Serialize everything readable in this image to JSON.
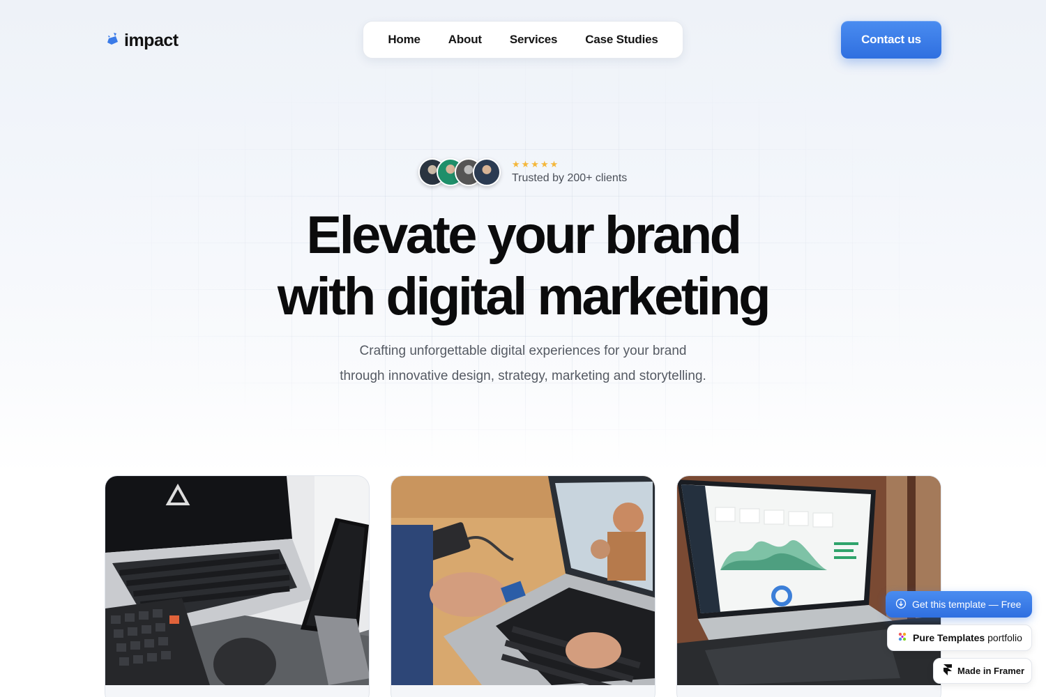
{
  "brand": {
    "name": "impact",
    "accent": "#2f6fe0"
  },
  "nav": {
    "items": [
      "Home",
      "About",
      "Services",
      "Case Studies"
    ]
  },
  "header": {
    "contact_label": "Contact us"
  },
  "trust": {
    "stars": "★★★★★",
    "rating": 5,
    "label": "Trusted by 200+ clients",
    "avatar_count": 4
  },
  "hero": {
    "headline_line1": "Elevate your brand",
    "headline_line2": "with digital marketing",
    "sub_line1": "Crafting unforgettable digital experiences for your brand",
    "sub_line2": "through innovative design, strategy, marketing and storytelling."
  },
  "cards": [
    {
      "image": "laptop-with-phone-stand-photo"
    },
    {
      "image": "person-inserting-sd-card-laptop-photo"
    },
    {
      "image": "laptop-analytics-dashboard-photo"
    }
  ],
  "floating": {
    "get_template": "Get this template — Free",
    "pure_templates_bold": "Pure Templates",
    "pure_templates_rest": " portfolio",
    "made_in_framer": "Made in Framer"
  }
}
